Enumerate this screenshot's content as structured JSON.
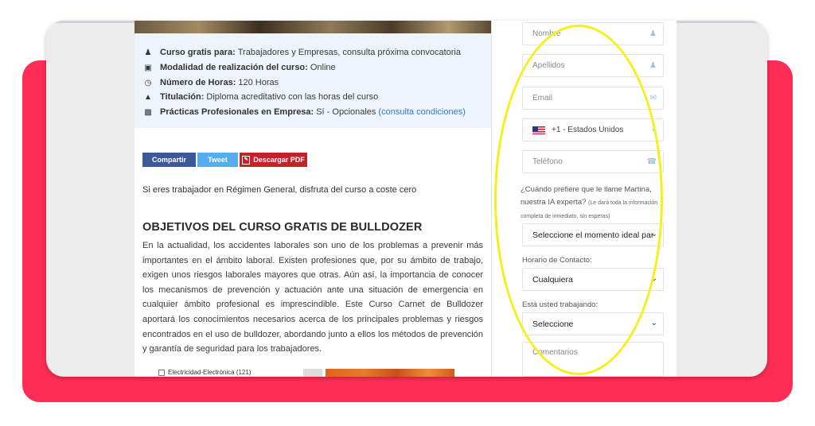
{
  "course_info": {
    "rows": [
      {
        "icon": "user-icon",
        "label": "Curso gratis para:",
        "value": "Trabajadores y Empresas, consulta próxima convocatoria"
      },
      {
        "icon": "laptop-icon",
        "label": "Modalidad de realización del curso:",
        "value": "Online"
      },
      {
        "icon": "clock-icon",
        "label": "Número de Horas:",
        "value": "120 Horas"
      },
      {
        "icon": "graduation-cap-icon",
        "label": "Titulación:",
        "value": "Diploma acreditativo con las horas del curso"
      },
      {
        "icon": "briefcase-icon",
        "label": "Prácticas Profesionales en Empresa:",
        "value": "Sí - Opcionales",
        "link": "(consulta condiciones)"
      }
    ]
  },
  "share": {
    "facebook_label": "Compartir",
    "twitter_label": "Tweet",
    "pdf_label": "Descargar PDF"
  },
  "intro": "Si eres trabajador en Régimen General, disfruta del curso a coste cero",
  "section": {
    "title": "OBJETIVOS DEL CURSO GRATIS DE BULLDOZER",
    "paragraph": "En la actualidad, los accidentes laborales son uno de los problemas a prevenir más importantes en el ámbito laboral. Existen profesiones que, por su ámbito de trabajo, exigen unos riesgos laborales mayores que otras. Aún así, la importancia de conocer los mecanismos de prevención y actuación ante una situación de emergencia en cualquier ámbito profesional es imprescindible. Este Curso Carnet de Bulldozer aportará los conocimientos necesarios acerca de los principales problemas y riesgos encontrados en el uso de bulldozer, abordando junto a ellos los métodos de prevención y garantía de seguridad para los trabajadores."
  },
  "bottom": {
    "category_label": "Electricidad-Electrónica (121)"
  },
  "form": {
    "name_placeholder": "Nombre",
    "surname_placeholder": "Apellidos",
    "email_placeholder": "Email",
    "country_value": "+1 - Estados Unidos",
    "phone_placeholder": "Teléfono",
    "call_question": "¿Cuándo prefiere que le llame Martina, nuestra IA experta?",
    "call_note": "(Le dará toda la información completa de inmediato, sin esperas)",
    "call_select": "Seleccione el momento ideal par",
    "contact_hours_label": "Horario de Contacto:",
    "contact_hours_value": "Cualquiera",
    "working_label": "Está usted trabajando:",
    "working_value": "Seleccione",
    "comments_placeholder": "Comentarios"
  },
  "colors": {
    "background_accent": "#ff2d55",
    "highlight": "#f5f01c",
    "link": "#2a7fd4",
    "facebook": "#3b5998",
    "twitter": "#55acee",
    "pdf": "#c4222a"
  }
}
